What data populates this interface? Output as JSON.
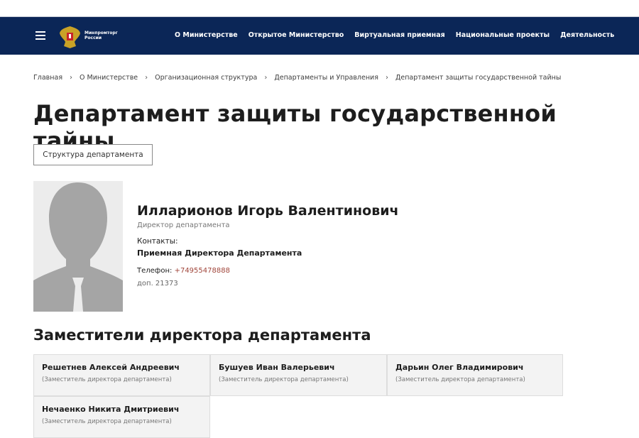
{
  "header": {
    "logo_text": [
      "Минпромторг",
      "России"
    ],
    "nav": [
      "О Министерстве",
      "Открытое Министерство",
      "Виртуальная приемная",
      "Национальные проекты",
      "Деятельность"
    ]
  },
  "breadcrumb": [
    "Главная",
    "О Министерстве",
    "Организационная структура",
    "Департаменты и Управления",
    "Департамент защиты государственной тайны"
  ],
  "page_title": "Департамент защиты государственной тайны",
  "structure_button": "Структура департамента",
  "director": {
    "name": "Илларионов Игорь Валентинович",
    "role": "Директор департамента",
    "contacts_label": "Контакты:",
    "contact_name": "Приемная Директора Департамента",
    "phone_label": "Телефон:",
    "phone": "+74955478888",
    "ext": "доп. 21373"
  },
  "deputies_title": "Заместители директора департамента",
  "deputies": [
    {
      "name": "Решетнев Алексей Андреевич",
      "position": "(Заместитель директора департамента)"
    },
    {
      "name": "Бушуев Иван Валерьевич",
      "position": "(Заместитель директора департамента)"
    },
    {
      "name": "Дарьин Олег Владимирович",
      "position": "(Заместитель директора департамента)"
    },
    {
      "name": "Нечаенко Никита Дмитриевич",
      "position": "(Заместитель директора департамента)"
    }
  ],
  "colors": {
    "header_bg": "#0b2657",
    "phone_link": "#a0453a"
  }
}
